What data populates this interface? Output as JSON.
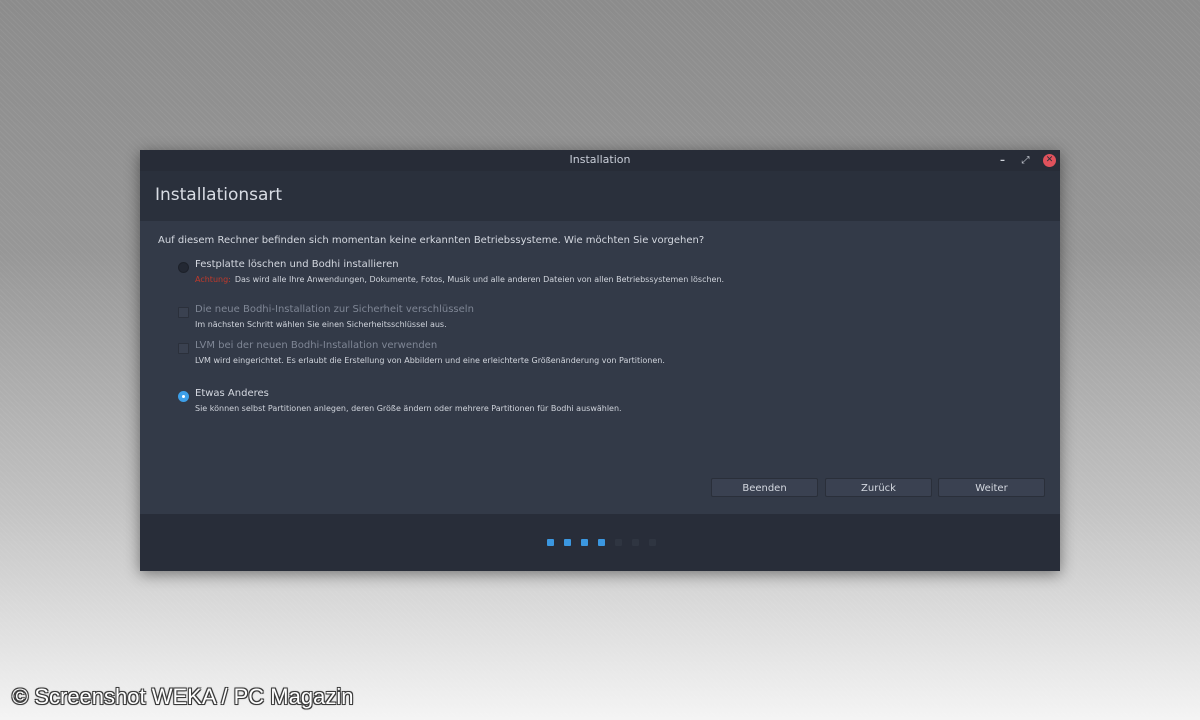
{
  "window": {
    "title": "Installation",
    "minimize_glyph": "–",
    "maximize_glyph": "⤢",
    "close_glyph": "✕"
  },
  "header": {
    "title": "Installationsart"
  },
  "content": {
    "question": "Auf diesem Rechner befinden sich momentan keine erkannten Betriebssysteme. Wie möchten Sie vorgehen?",
    "options": [
      {
        "label": "Festplatte löschen und Bodhi installieren",
        "warning": "Achtung:",
        "description": "Das wird alle Ihre Anwendungen, Dokumente, Fotos, Musik und alle anderen Dateien von allen Betriebssystemen löschen.",
        "control": "radio",
        "checked": false,
        "enabled": true
      },
      {
        "label": "Die neue Bodhi-Installation zur Sicherheit verschlüsseln",
        "description": "Im nächsten Schritt wählen Sie einen Sicherheitsschlüssel aus.",
        "control": "checkbox",
        "checked": false,
        "enabled": false
      },
      {
        "label": "LVM bei der neuen Bodhi-Installation verwenden",
        "description": "LVM wird eingerichtet. Es erlaubt die Erstellung von Abbildern und eine erleichterte Größenänderung von Partitionen.",
        "control": "checkbox",
        "checked": false,
        "enabled": false
      },
      {
        "label": "Etwas Anderes",
        "description": "Sie können selbst Partitionen anlegen, deren Größe ändern oder mehrere Partitionen für Bodhi auswählen.",
        "control": "radio",
        "checked": true,
        "enabled": true
      }
    ]
  },
  "buttons": {
    "quit": "Beenden",
    "back": "Zurück",
    "next": "Weiter"
  },
  "progress": {
    "total_steps": 7,
    "completed_steps": 4
  },
  "colors": {
    "accent": "#3b97e0",
    "warning": "#c0392b",
    "close": "#e0525c"
  },
  "watermark": "© Screenshot WEKA / PC Magazin"
}
